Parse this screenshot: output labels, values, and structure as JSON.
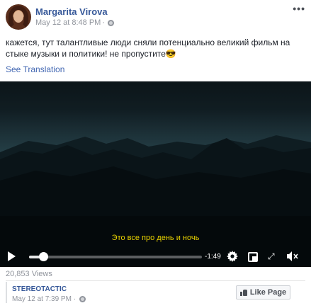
{
  "post": {
    "author": "Margarita Virova",
    "timestamp": "May 12 at 8:48 PM",
    "privacy_icon": "globe-icon",
    "more_label": "•••",
    "text": "кажется, тут талантливые люди сняли потенциально великий фильм на стыке музыки и политики! не пропустите😎",
    "see_translation": "See Translation"
  },
  "video": {
    "subtitle": "Это все про день и ночь",
    "time_remaining": "-1:49",
    "progress": 0.08,
    "icons": [
      "play-icon",
      "gear-icon",
      "picture-in-picture-icon",
      "fullscreen-icon",
      "volume-muted-icon"
    ],
    "expand_glyph": "⤢",
    "volume_glyph": "🔇"
  },
  "footer": {
    "views": "20,853 Views",
    "page_name": "STEREOTACTIC",
    "page_timestamp": "May 12 at 7:39 PM",
    "like_page_label": "Like Page"
  }
}
